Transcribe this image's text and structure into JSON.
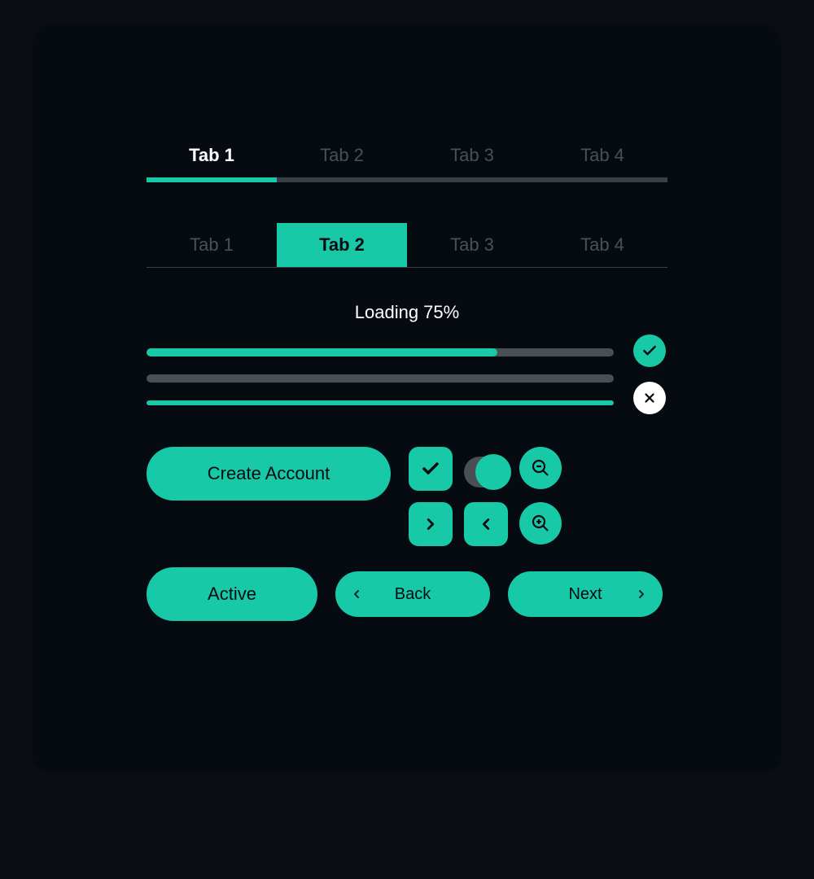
{
  "colors": {
    "accent": "#17c9a7",
    "bg": "#060b12",
    "muted": "#4a5058"
  },
  "tabs_a": {
    "items": [
      {
        "label": "Tab 1",
        "active": true
      },
      {
        "label": "Tab 2",
        "active": false
      },
      {
        "label": "Tab 3",
        "active": false
      },
      {
        "label": "Tab 4",
        "active": false
      }
    ]
  },
  "tabs_b": {
    "items": [
      {
        "label": "Tab 1",
        "active": false
      },
      {
        "label": "Tab 2",
        "active": true
      },
      {
        "label": "Tab 3",
        "active": false
      },
      {
        "label": "Tab 4",
        "active": false
      }
    ]
  },
  "loading": {
    "label": "Loading 75%",
    "bars": [
      {
        "percent": 75
      },
      {
        "percent": 0
      },
      {
        "percent": 100
      }
    ]
  },
  "status": {
    "success_icon": "check-icon",
    "error_icon": "close-icon"
  },
  "buttons": {
    "create_label": "Create Account",
    "active_label": "Active",
    "back_label": "Back",
    "next_label": "Next"
  },
  "controls": {
    "checkbox_checked": true,
    "toggle_on": true
  },
  "icons": {
    "checkbox": "check-icon",
    "forward": "chevron-right-icon",
    "backward": "chevron-left-icon",
    "zoom_out": "zoom-out-icon",
    "zoom_in": "zoom-in-icon"
  }
}
